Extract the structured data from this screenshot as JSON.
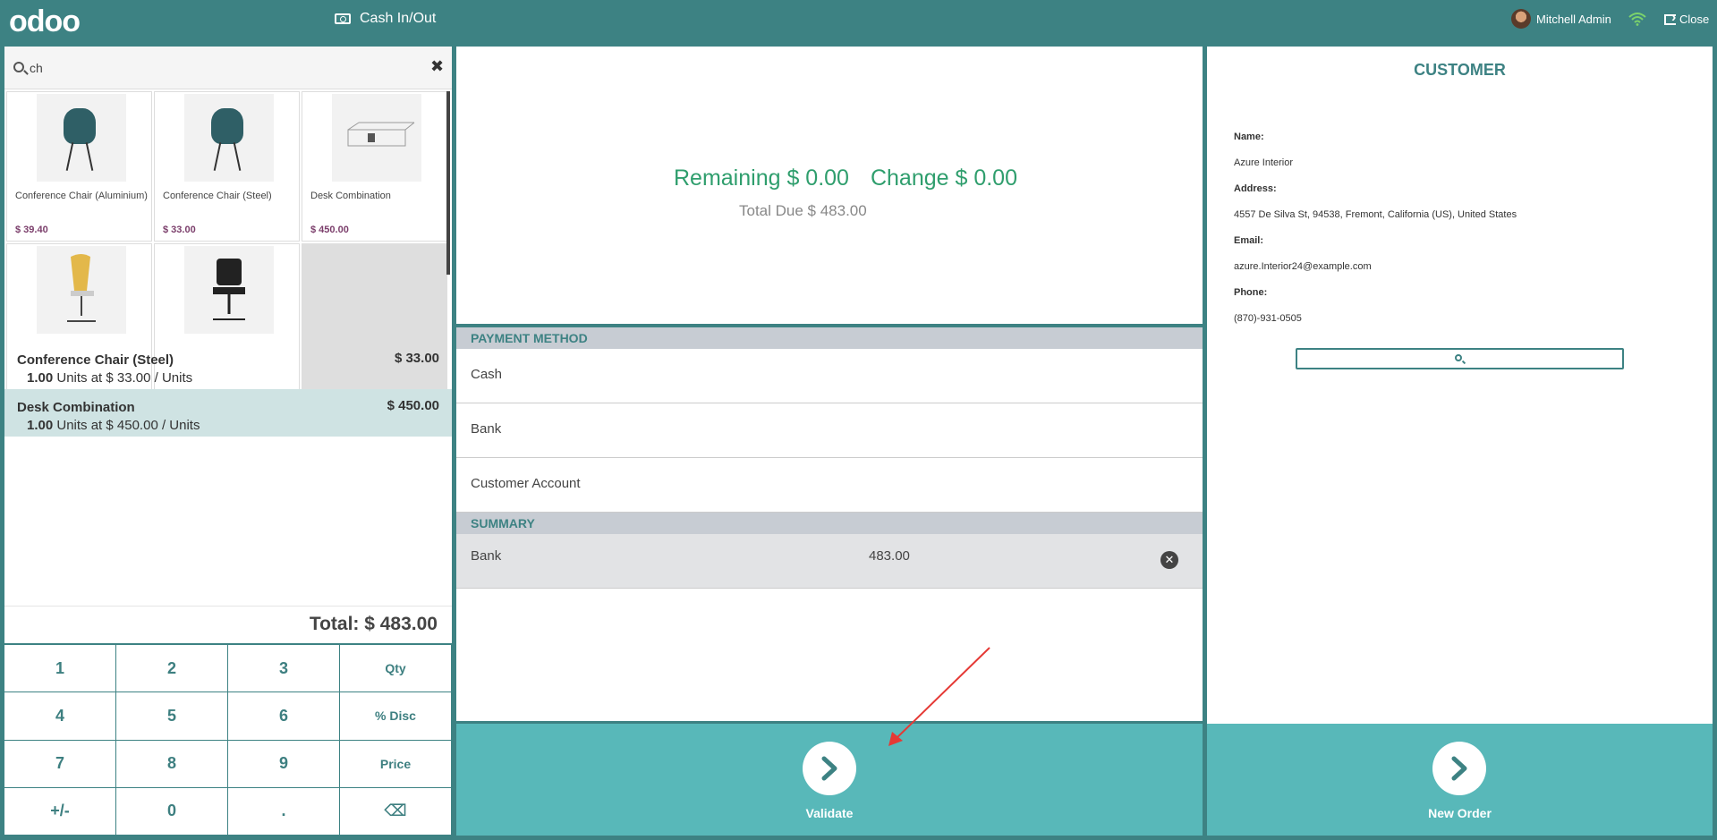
{
  "app": {
    "logo": "odoo",
    "cash_label": "Cash In/Out",
    "user_name": "Mitchell Admin",
    "close_label": "Close"
  },
  "search": {
    "value": "ch"
  },
  "products": [
    {
      "name": "Conference Chair (Aluminium)",
      "price": "$ 39.40"
    },
    {
      "name": "Conference Chair (Steel)",
      "price": "$ 33.00"
    },
    {
      "name": "Desk Combination",
      "price": "$ 450.00"
    },
    {
      "name": "",
      "price": ""
    },
    {
      "name": "",
      "price": ""
    }
  ],
  "orderlines": [
    {
      "name": "Conference Chair (Steel)",
      "price": "$ 33.00",
      "qty": "1.00",
      "detail": "Units at $ 33.00 / Units"
    },
    {
      "name": "Desk Combination",
      "price": "$ 450.00",
      "qty": "1.00",
      "detail": "Units at $ 450.00 / Units"
    }
  ],
  "total": "Total: $ 483.00",
  "numpad": [
    "1",
    "2",
    "3",
    "Qty",
    "4",
    "5",
    "6",
    "% Disc",
    "7",
    "8",
    "9",
    "Price",
    "+/-",
    "0",
    ".",
    "⌫"
  ],
  "payment": {
    "remaining": "Remaining $ 0.00",
    "change": "Change $ 0.00",
    "total_due": "Total Due  $ 483.00",
    "method_header": "PAYMENT METHOD",
    "methods": [
      "Cash",
      "Bank",
      "Customer Account"
    ],
    "summary_header": "SUMMARY",
    "summary_line": {
      "method": "Bank",
      "amount": "483.00"
    },
    "validate_label": "Validate"
  },
  "customer": {
    "title": "CUSTOMER",
    "name_label": "Name:",
    "name": "Azure Interior",
    "address_label": "Address:",
    "address": "4557 De Silva St, 94538, Fremont, California (US), United States",
    "email_label": "Email:",
    "email": "azure.Interior24@example.com",
    "phone_label": "Phone:",
    "phone": "(870)-931-0505",
    "new_order_label": "New Order"
  },
  "colors": {
    "brand": "#3d8283",
    "action": "#58b8b9",
    "positive": "#2f9e6d",
    "selected_line": "#cfe3e3"
  }
}
